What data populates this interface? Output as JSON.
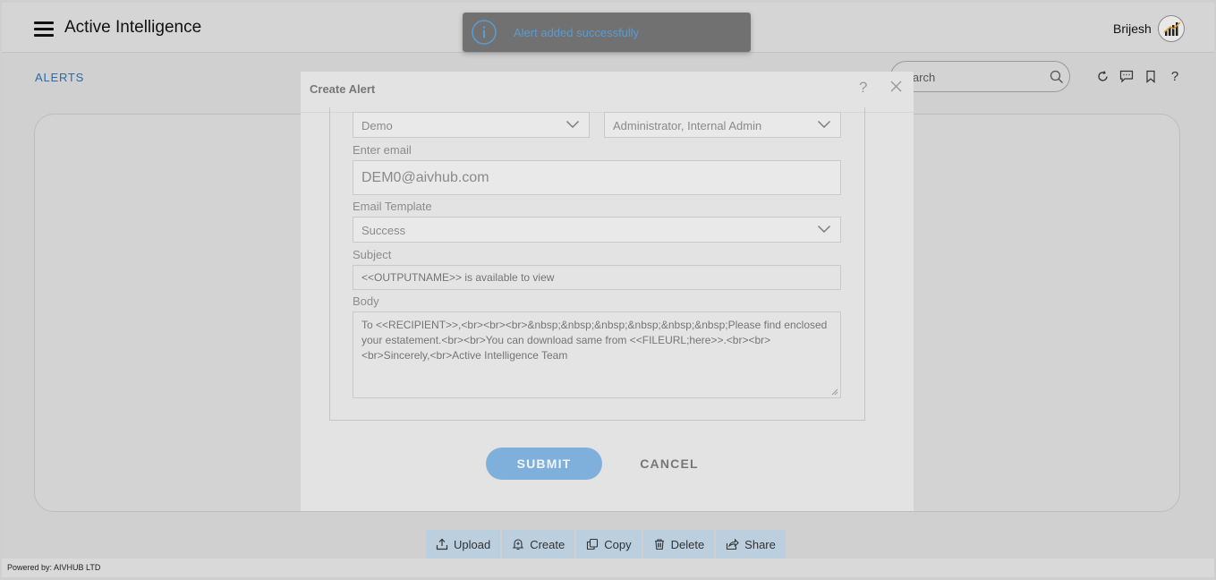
{
  "header": {
    "app_title": "Active Intelligence",
    "user_name": "Brijesh"
  },
  "subheader": {
    "page_label": "ALERTS",
    "search_placeholder": "Search"
  },
  "toast": {
    "message": "Alert added successfully"
  },
  "modal": {
    "title": "Create Alert",
    "help": "?",
    "fields": {
      "select_one_value": "Demo",
      "select_two_value": "Administrator, Internal Admin",
      "email_label": "Enter email",
      "email_value": "DEM0@aivhub.com",
      "template_label": "Email Template",
      "template_value": "Success",
      "subject_label": "Subject",
      "subject_placeholder": "<<OUTPUTNAME>> is available to view",
      "body_label": "Body",
      "body_placeholder": "To <<RECIPIENT>>,<br><br><br>&nbsp;&nbsp;&nbsp;&nbsp;&nbsp;&nbsp;Please find enclosed your estatement.<br><br>You can download same from <<FILEURL;here>>.<br><br><br>Sincerely,<br>Active Intelligence Team"
    },
    "submit_label": "SUBMIT",
    "cancel_label": "CANCEL"
  },
  "toolbar": {
    "upload": "Upload",
    "create": "Create",
    "copy": "Copy",
    "delete": "Delete",
    "share": "Share"
  },
  "footer": {
    "powered_by": "Powered by: AIVHUB LTD"
  },
  "icons": {
    "menu": "hamburger-icon",
    "avatar": "bar-chart-logo-icon",
    "search": "search-icon",
    "refresh": "refresh-icon",
    "comment": "comment-icon",
    "bookmark": "bookmark-icon",
    "help": "help-icon",
    "info": "info-icon",
    "close": "close-icon"
  },
  "colors": {
    "accent": "#2a6aa8",
    "submit": "#7fb0dc",
    "toolbar_button": "#bccfdf",
    "toast_bg": "#717171",
    "toast_text": "#5a9bd0"
  }
}
